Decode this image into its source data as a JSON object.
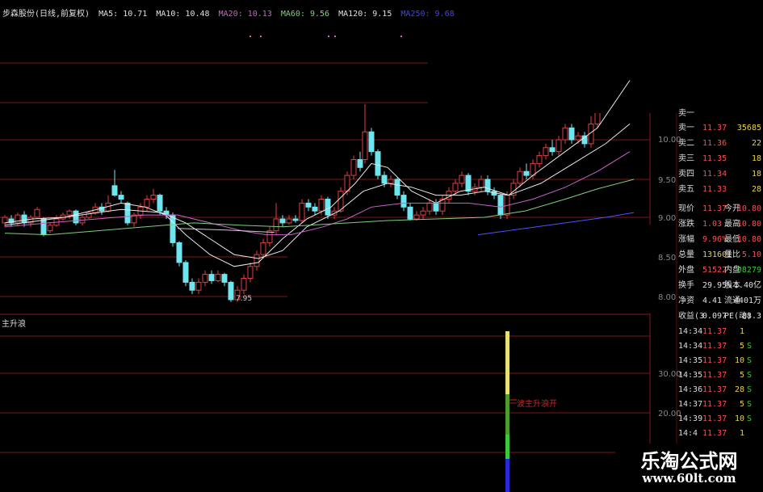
{
  "header": {
    "stock_title": "步森股份(日线,前复权)",
    "ma": [
      {
        "label": "MA5: 10.71",
        "color": "#e0e0e0"
      },
      {
        "label": "MA10: 10.48",
        "color": "#e0e0e0"
      },
      {
        "label": "MA20: 10.13",
        "color": "#c864c8"
      },
      {
        "label": "MA60: 9.56",
        "color": "#7ecf7e"
      },
      {
        "label": "MA120: 9.15",
        "color": "#e0e0e0"
      },
      {
        "label": "MA250: 9.68",
        "color": "#4040ff"
      }
    ]
  },
  "indicator": {
    "title": "主升浪",
    "signal_label": "一波主升浪开"
  },
  "axis": {
    "price_ticks": [
      "10.00",
      "9.50",
      "9.00",
      "8.50",
      "8.00"
    ],
    "ind_ticks": [
      "30.00",
      "20.00"
    ],
    "low_marker": "7.95"
  },
  "quote": {
    "top_cut": "卖一",
    "asks": [
      {
        "label": "卖一",
        "price": "11.37",
        "vol": "35685"
      },
      {
        "label": "卖二",
        "price": "11.36",
        "vol": "22"
      },
      {
        "label": "卖三",
        "price": "11.35",
        "vol": "18"
      },
      {
        "label": "卖四",
        "price": "11.34",
        "vol": "18"
      },
      {
        "label": "卖五",
        "price": "11.33",
        "vol": "28"
      }
    ],
    "stats": [
      {
        "l1": "现价",
        "v1": "11.37",
        "l2": "今开",
        "v2": "10.80",
        "c1": "#ff4d4d",
        "c2": "#ff4d4d"
      },
      {
        "l1": "涨跌",
        "v1": "1.03",
        "l2": "最高",
        "v2": "10.80",
        "c1": "#ff4d4d",
        "c2": "#ff4d4d"
      },
      {
        "l1": "涨幅",
        "v1": "9.96%",
        "l2": "最低",
        "v2": "10.80",
        "c1": "#ff4d4d",
        "c2": "#ff4d4d"
      },
      {
        "l1": "总量",
        "v1": "131601",
        "l2": "量比",
        "v2": "5.10",
        "c1": "#e8d24a",
        "c2": "#ff4d4d"
      },
      {
        "l1": "外盘",
        "v1": "51522",
        "l2": "内盘",
        "v2": "08279",
        "c1": "#ff4d4d",
        "c2": "#33cc33"
      },
      {
        "l1": "换手",
        "v1": "29.95%",
        "l2": "股本",
        "v2": "1.40亿",
        "c1": "#e0e0e0",
        "c2": "#e0e0e0"
      },
      {
        "l1": "净资",
        "v1": "4.41",
        "l2": "流通",
        "v2": "4401万",
        "c1": "#e0e0e0",
        "c2": "#e0e0e0"
      },
      {
        "l1": "收益(3",
        "v1": "0.097",
        "l2": "PE(动)",
        "v2": "88.3",
        "c1": "#e0e0e0",
        "c2": "#e0e0e0"
      }
    ],
    "ticks": [
      {
        "time": "14:34",
        "price": "11.37",
        "vol": "1",
        "bs": ""
      },
      {
        "time": "14:34",
        "price": "11.37",
        "vol": "5",
        "bs": "S"
      },
      {
        "time": "14:35",
        "price": "11.37",
        "vol": "10",
        "bs": "S"
      },
      {
        "time": "14:35",
        "price": "11.37",
        "vol": "5",
        "bs": "S"
      },
      {
        "time": "14:36",
        "price": "11.37",
        "vol": "28",
        "bs": "S"
      },
      {
        "time": "14:37",
        "price": "11.37",
        "vol": "5",
        "bs": "S"
      },
      {
        "time": "14:39",
        "price": "11.37",
        "vol": "10",
        "bs": "S"
      },
      {
        "time": "14:4",
        "price": "11.37",
        "vol": "1",
        "bs": ""
      }
    ]
  },
  "watermark": {
    "name": "乐淘公式网",
    "url": "www.60lt.com"
  },
  "colors": {
    "up": "#e04040",
    "down": "#6ee6f0",
    "ma5": "#e8e8e8",
    "ma10": "#e8e8e8",
    "ma20": "#c864c8",
    "ma60": "#7ecf7e",
    "ma120": "#5050ff",
    "grid": "#7a1a1a"
  }
}
